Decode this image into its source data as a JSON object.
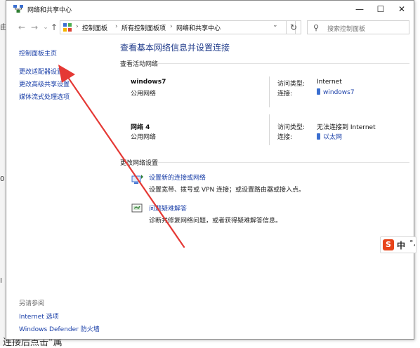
{
  "window": {
    "title": "网络和共享中心",
    "buttons": {
      "minimize": "—",
      "maximize": "☐",
      "close": "✕"
    }
  },
  "address": {
    "crumbs": [
      "控制面板",
      "所有控制面板项",
      "网络和共享中心"
    ],
    "search_placeholder": "搜索控制面板"
  },
  "sidebar": {
    "home": "控制面板主页",
    "items": [
      "更改适配器设置",
      "更改高级共享设置",
      "媒体流式处理选项"
    ],
    "see_also_title": "另请参阅",
    "see_also": [
      "Internet 选项",
      "Windows Defender 防火墙"
    ]
  },
  "main": {
    "heading": "查看基本网络信息并设置连接",
    "active_networks_title": "查看活动网络",
    "networks": [
      {
        "name": "windows7",
        "category": "公用网络",
        "access_label": "访问类型:",
        "access_value": "Internet",
        "conn_label": "连接:",
        "conn_value": "windows7"
      },
      {
        "name": "网络 4",
        "category": "公用网络",
        "access_label": "访问类型:",
        "access_value": "无法连接到 Internet",
        "conn_label": "连接:",
        "conn_value": "以太网"
      }
    ],
    "change_settings_title": "更改网络设置",
    "tasks": [
      {
        "link": "设置新的连接或网络",
        "desc": "设置宽带、拨号或 VPN 连接；或设置路由器或接入点。"
      },
      {
        "link": "问题疑难解答",
        "desc": "诊断并修复网络问题，或者获得疑难解答信息。"
      }
    ]
  },
  "background": {
    "left_glyphs": [
      "由",
      "0",
      "I"
    ],
    "caption": "连接后点击“属"
  },
  "ime": {
    "label": "中",
    "punct": "°,"
  },
  "colors": {
    "link": "#1a3fa8",
    "heading": "#1e3a8a",
    "arrow": "#e53935",
    "ime_logo": "#e8441a"
  }
}
